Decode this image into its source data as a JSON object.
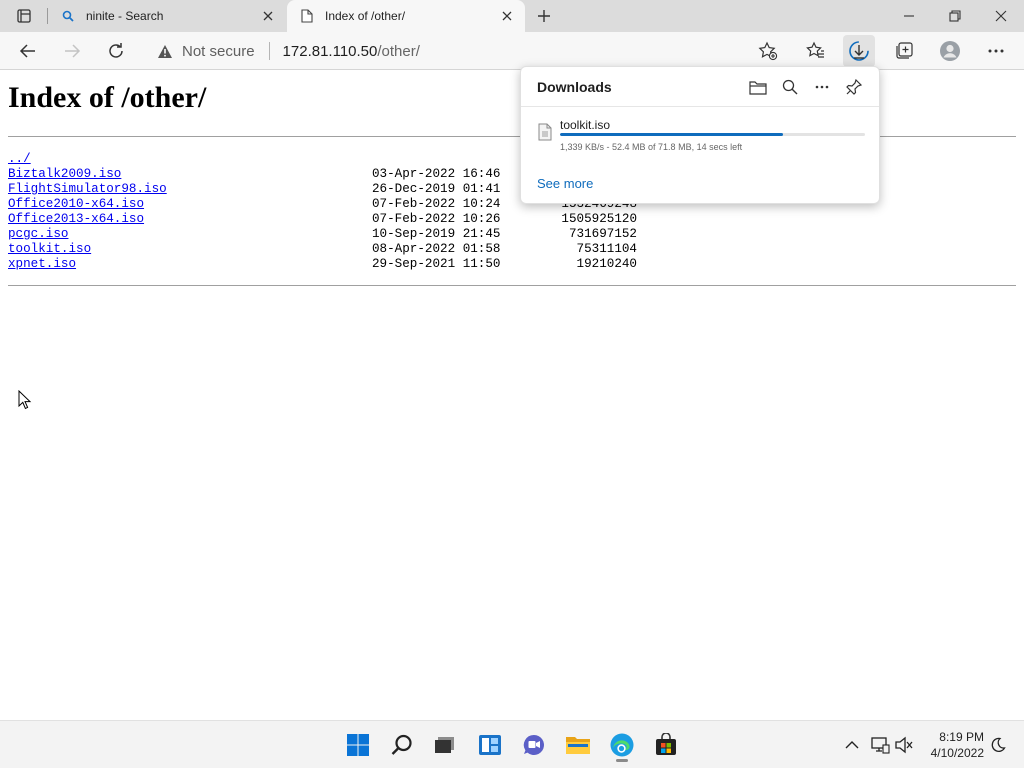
{
  "browser": {
    "tabs": [
      {
        "title": "ninite - Search",
        "icon": "search-icon"
      },
      {
        "title": "Index of /other/",
        "icon": "page-icon"
      }
    ],
    "address": {
      "security_label": "Not secure",
      "host": "172.81.110.50",
      "path": "/other/"
    }
  },
  "page": {
    "heading": "Index of /other/",
    "parent_link": "../",
    "files": [
      {
        "name": "Biztalk2009.iso",
        "date": "03-Apr-2022 16:46",
        "size": ""
      },
      {
        "name": "FlightSimulator98.iso",
        "date": "26-Dec-2019 01:41",
        "size": ""
      },
      {
        "name": "Office2010-x64.iso",
        "date": "07-Feb-2022 10:24",
        "size": "1532469248"
      },
      {
        "name": "Office2013-x64.iso",
        "date": "07-Feb-2022 10:26",
        "size": "1505925120"
      },
      {
        "name": "pcgc.iso",
        "date": "10-Sep-2019 21:45",
        "size": "731697152"
      },
      {
        "name": "toolkit.iso",
        "date": "08-Apr-2022 01:58",
        "size": "75311104"
      },
      {
        "name": "xpnet.iso",
        "date": "29-Sep-2021 11:50",
        "size": "19210240"
      }
    ]
  },
  "downloads": {
    "title": "Downloads",
    "item": {
      "filename": "toolkit.iso",
      "status": "1,339 KB/s - 52.4 MB of 71.8 MB, 14 secs left",
      "progress_fraction": 0.73
    },
    "see_more": "See more"
  },
  "taskbar": {
    "time": "8:19 PM",
    "date": "4/10/2022"
  },
  "colors": {
    "accent": "#0f6cbd",
    "link": "#0000ee"
  }
}
